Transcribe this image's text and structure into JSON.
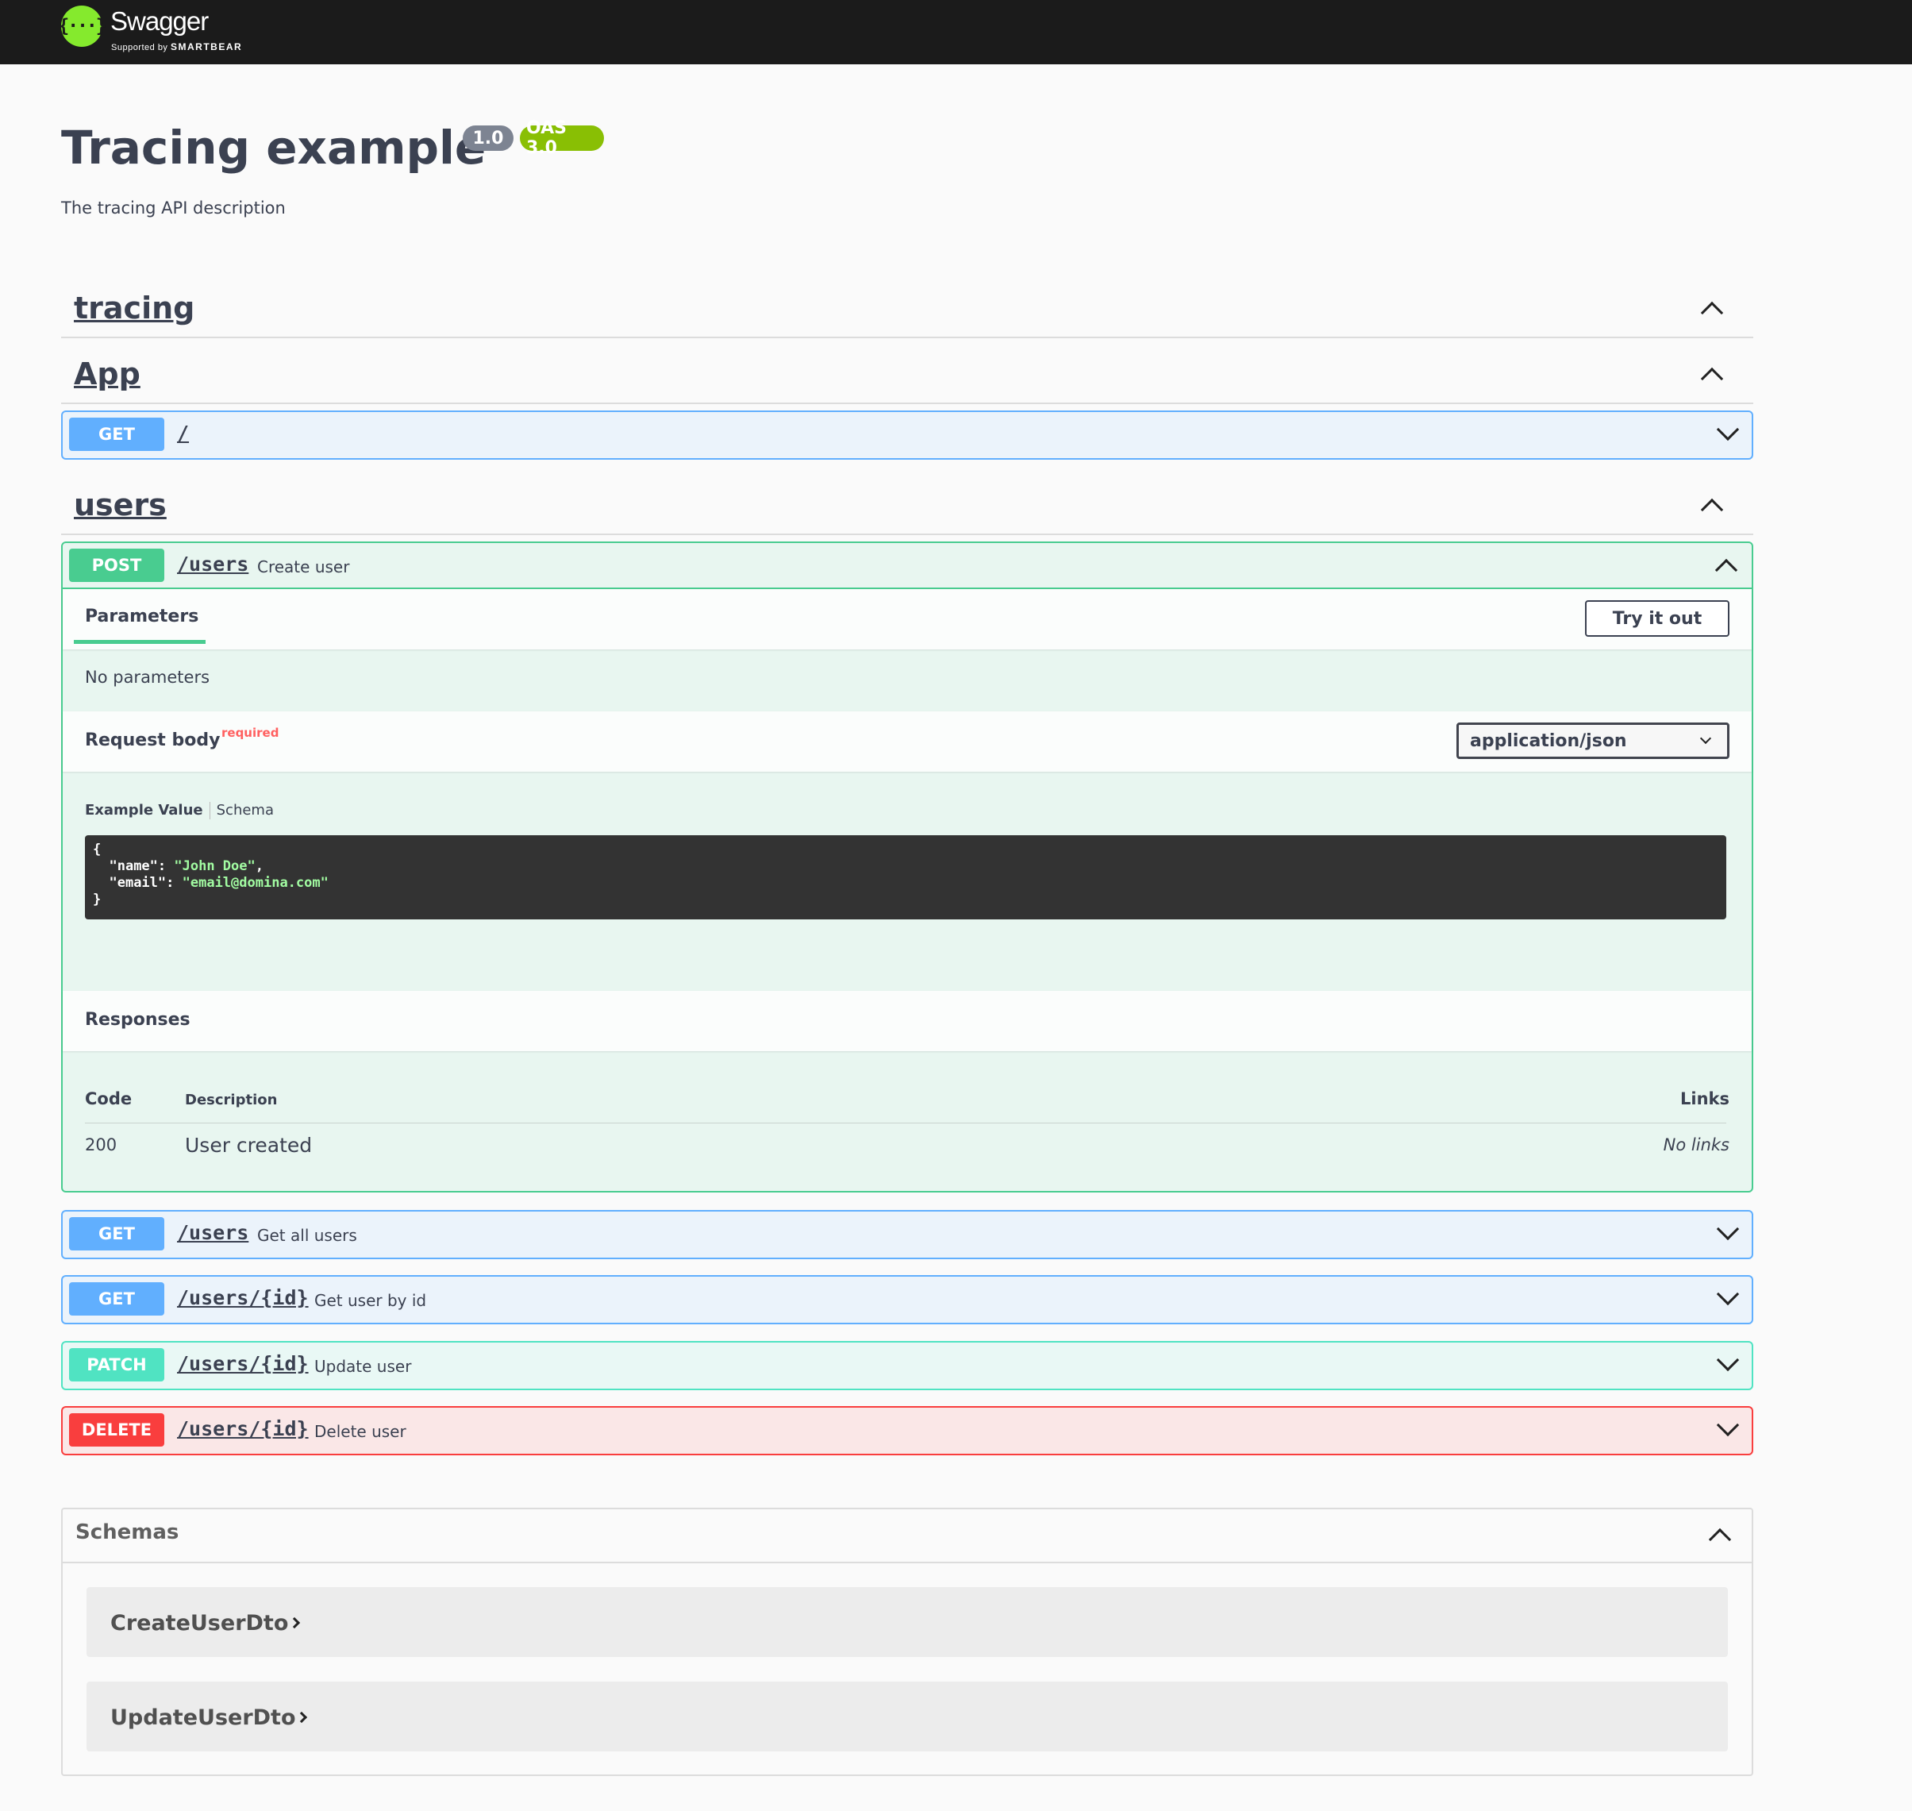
{
  "topbar": {
    "logo_glyph": "{···}",
    "logo_text": "Swagger",
    "logo_sub_prefix": "Supported by",
    "logo_sub_brand": "SMARTBEAR"
  },
  "info": {
    "title": "Tracing example",
    "version": "1.0",
    "oas": "OAS 3.0",
    "description": "The tracing API description"
  },
  "tags": [
    {
      "name": "tracing"
    },
    {
      "name": "App"
    },
    {
      "name": "users"
    }
  ],
  "operations": {
    "app_get_root": {
      "method": "GET",
      "path": "/",
      "summary": ""
    },
    "create_user": {
      "method": "POST",
      "path": "/users",
      "summary": "Create user"
    },
    "get_all_users": {
      "method": "GET",
      "path": "/users",
      "summary": "Get all users"
    },
    "get_user": {
      "method": "GET",
      "path": "/users/{id}",
      "summary": "Get user by id"
    },
    "patch_user": {
      "method": "PATCH",
      "path": "/users/{id}",
      "summary": "Update user"
    },
    "delete_user": {
      "method": "DELETE",
      "path": "/users/{id}",
      "summary": "Delete user"
    }
  },
  "create_user_detail": {
    "parameters_tab": "Parameters",
    "try_it_out": "Try it out",
    "no_parameters": "No parameters",
    "request_body_label": "Request body",
    "required_label": "required",
    "content_type": "application/json",
    "example_value_tab": "Example Value",
    "schema_tab": "Schema",
    "example": {
      "open": "{",
      "name_key": "\"name\"",
      "name_value": "\"John Doe\"",
      "email_key": "\"email\"",
      "email_value": "\"email@domina.com\"",
      "close": "}"
    },
    "responses_label": "Responses",
    "responses_columns": {
      "code": "Code",
      "description": "Description",
      "links": "Links"
    },
    "responses": [
      {
        "code": "200",
        "description": "User created",
        "links": "No links"
      }
    ]
  },
  "schemas": {
    "title": "Schemas",
    "items": [
      "CreateUserDto",
      "UpdateUserDto"
    ]
  },
  "colors": {
    "get": "#61affe",
    "post": "#49cc90",
    "patch": "#50e3c2",
    "delete": "#f93e3e",
    "brand": "#85ea2d"
  }
}
